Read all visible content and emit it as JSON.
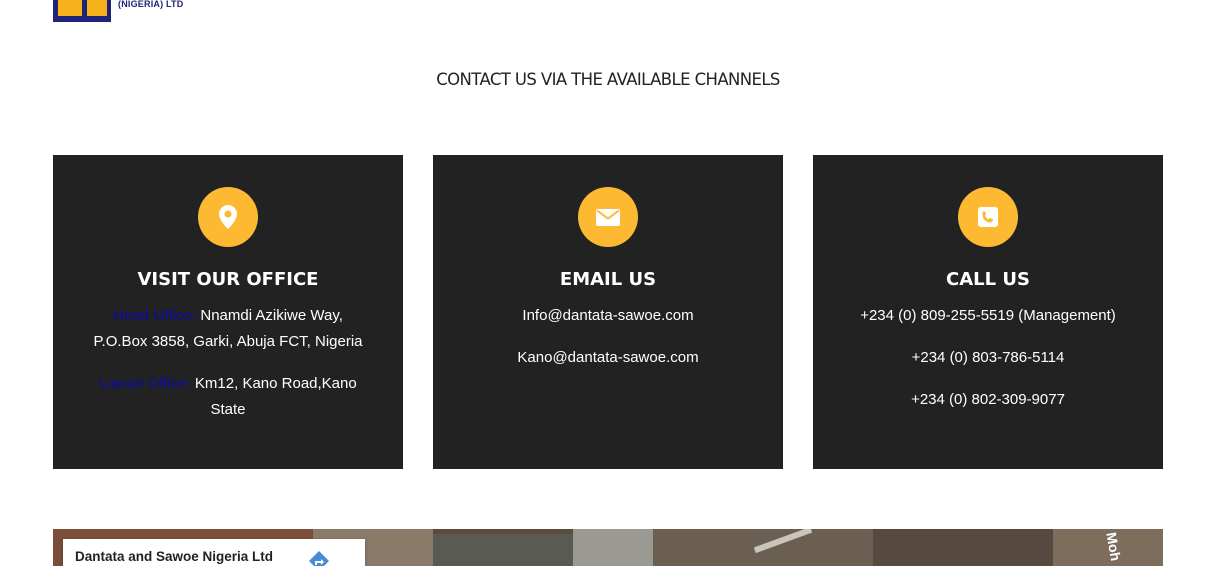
{
  "brand": {
    "logo_subtext": "(NIGERIA) LTD"
  },
  "section": {
    "title": "CONTACT US VIA THE AVAILABLE CHANNELS"
  },
  "cards": [
    {
      "icon": "location-pin-icon",
      "title": "VISIT OUR OFFICE",
      "head_label": "Head Office:",
      "head_line1": "Nnamdi Azikiwe Way,",
      "head_line2": "P.O.Box 3858, Garki, Abuja FCT, Nigeria",
      "liaison_label": "Liason Office:",
      "liaison_line1": "Km12, Kano Road,Kano",
      "liaison_line2": "State"
    },
    {
      "icon": "envelope-icon",
      "title": "EMAIL US",
      "email1": "Info@dantata-sawoe.com",
      "email2": "Kano@dantata-sawoe.com"
    },
    {
      "icon": "phone-icon",
      "title": "CALL US",
      "phone1": "+234 (0) 809-255-5519 (Management)",
      "phone2": "+234 (0) 803-786-5114",
      "phone3": "+234 (0) 802-309-9077"
    }
  ],
  "map": {
    "place_name": "Dantata and Sawoe Nigeria Ltd",
    "edge_label": "Moh",
    "directions_icon": "directions-icon"
  },
  "colors": {
    "card_bg": "#222222",
    "accent": "#fdb932",
    "label_blue": "#0b0ba8"
  }
}
